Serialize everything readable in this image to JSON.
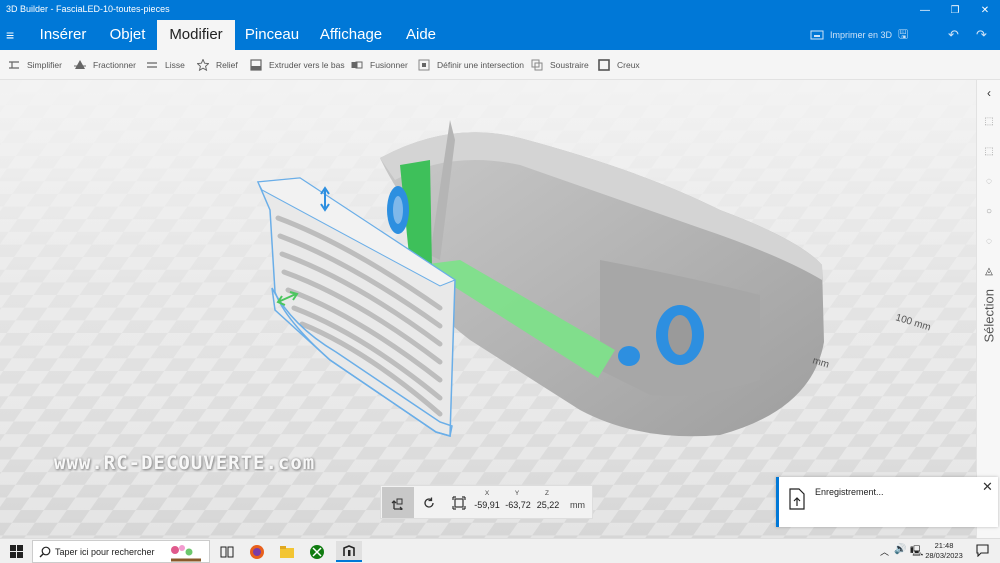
{
  "window": {
    "title": "3D Builder - FasciaLED-10-toutes-pieces"
  },
  "menu": {
    "tabs": [
      {
        "label": "Insérer"
      },
      {
        "label": "Objet"
      },
      {
        "label": "Modifier"
      },
      {
        "label": "Pinceau"
      },
      {
        "label": "Affichage"
      },
      {
        "label": "Aide"
      }
    ],
    "active_tab": "Modifier",
    "print_label": "Imprimer en 3D"
  },
  "toolbar": {
    "tools": [
      {
        "label": "Simplifier",
        "icon": "simplify-icon"
      },
      {
        "label": "Fractionner",
        "icon": "split-icon"
      },
      {
        "label": "Lisse",
        "icon": "smooth-icon"
      },
      {
        "label": "Relief",
        "icon": "emboss-icon"
      },
      {
        "label": "Extruder vers le bas",
        "icon": "extrude-down-icon"
      },
      {
        "label": "Fusionner",
        "icon": "merge-icon"
      },
      {
        "label": "Définir une intersection",
        "icon": "intersect-icon"
      },
      {
        "label": "Soustraire",
        "icon": "subtract-icon"
      },
      {
        "label": "Creux",
        "icon": "hollow-icon"
      }
    ]
  },
  "canvas": {
    "ruler_label_1": "100 mm",
    "ruler_label_2": "mm",
    "watermark": "www.RC-DECOUVERTE.com"
  },
  "right_panel": {
    "label": "Sélection"
  },
  "coordinates": {
    "x_label": "X",
    "y_label": "Y",
    "z_label": "Z",
    "x_value": "-59,91",
    "y_value": "-63,72",
    "z_value": "25,22",
    "unit": "mm"
  },
  "notification": {
    "text": "Enregistrement..."
  },
  "taskbar": {
    "search_placeholder": "Taper ici pour rechercher",
    "time": "21:48",
    "date": "28/03/2023"
  },
  "colors": {
    "accent": "#0078d7",
    "selection_outline": "#6aaee8",
    "green_part": "#3ec05a",
    "blue_part": "#2d8fe0"
  }
}
